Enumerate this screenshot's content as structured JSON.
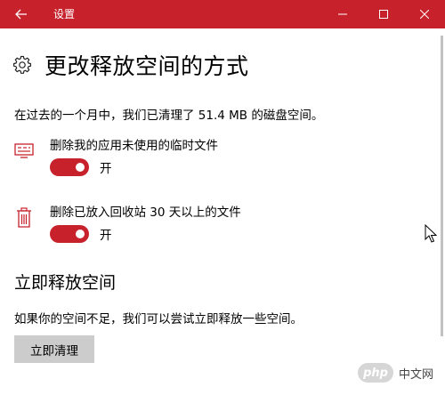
{
  "window": {
    "title": "设置"
  },
  "page": {
    "title": "更改释放空间的方式",
    "info": "在过去的一个月中，我们已清理了 51.4 MB 的磁盘空间。"
  },
  "options": [
    {
      "icon": "monitor-icon",
      "label": "删除我的应用未使用的临时文件",
      "state": "开",
      "on": true
    },
    {
      "icon": "trash-icon",
      "label": "删除已放入回收站 30 天以上的文件",
      "state": "开",
      "on": true
    }
  ],
  "free_now": {
    "title": "立即释放空间",
    "description": "如果你的空间不足，我们可以尝试立即释放一些空间。",
    "button": "立即清理"
  },
  "watermark": {
    "logo": "php",
    "text": "中文网"
  },
  "colors": {
    "accent": "#c7222c",
    "button_bg": "#cccccc"
  }
}
